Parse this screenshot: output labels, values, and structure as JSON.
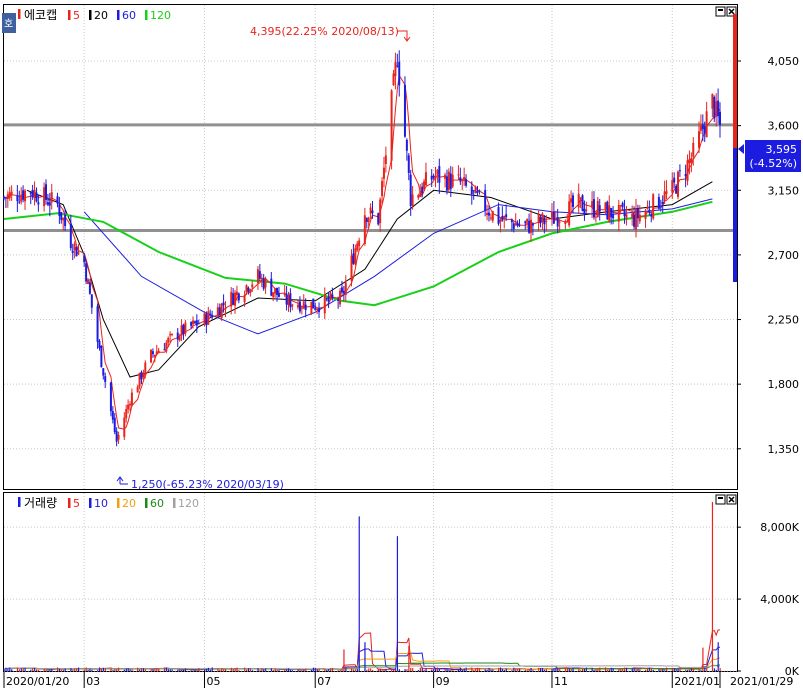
{
  "header": {
    "corner_label": "호",
    "price_title": "에코캡",
    "price_legend": [
      {
        "label": "5",
        "color": "#e8241c"
      },
      {
        "label": "20",
        "color": "#000000"
      },
      {
        "label": "60",
        "color": "#1c1ce0"
      },
      {
        "label": "120",
        "color": "#18d018"
      }
    ],
    "volume_title": "거래량",
    "volume_legend": [
      {
        "label": "5",
        "color": "#e8241c"
      },
      {
        "label": "10",
        "color": "#1c1ce0"
      },
      {
        "label": "20",
        "color": "#f0a010"
      },
      {
        "label": "60",
        "color": "#1a8a1a"
      },
      {
        "label": "120",
        "color": "#a0a0a0"
      }
    ]
  },
  "annotations": {
    "high": "4,395(22.25% 2020/08/13)",
    "low": "1,250(-65.23% 2020/03/19)"
  },
  "current": {
    "price": "3,595",
    "change": "(-4.52%)"
  },
  "colors": {
    "up": "#e8241c",
    "down": "#1c1ce0",
    "grid": "#c8c8c8",
    "level_line": "#909090",
    "ma5": "#e8241c",
    "ma20": "#000000",
    "ma60": "#1c1ce0",
    "ma120": "#18d018"
  },
  "chart_data": [
    {
      "type": "candlestick",
      "title": "에코캡",
      "y_ticks": [
        1350,
        1800,
        2250,
        2700,
        3150,
        3600,
        4050
      ],
      "y_tick_labels": [
        "1,350",
        "1,800",
        "2,250",
        "2,700",
        "3,150",
        "3,600",
        "4,050"
      ],
      "ylim": [
        1070,
        4440
      ],
      "horizontal_levels": [
        3605,
        2870
      ],
      "x_ticks": [
        {
          "label": "2020/01/20",
          "date": "2020/01/20"
        },
        {
          "label": "03",
          "date": "2020/03/02"
        },
        {
          "label": "05",
          "date": "2020/05/04"
        },
        {
          "label": "07",
          "date": "2020/07/01"
        },
        {
          "label": "09",
          "date": "2020/09/01"
        },
        {
          "label": "11",
          "date": "2020/11/02"
        },
        {
          "label": "2021/01",
          "date": "2021/01/04"
        },
        {
          "label": "2021/01/29",
          "date": "2021/01/29"
        }
      ],
      "x_range": [
        "2020/01/20",
        "2021/01/29"
      ],
      "series_close": [
        [
          "2020/01/20",
          3100
        ],
        [
          "2020/02/03",
          3150
        ],
        [
          "2020/02/17",
          3050
        ],
        [
          "2020/02/24",
          2800
        ],
        [
          "2020/03/02",
          2650
        ],
        [
          "2020/03/09",
          2100
        ],
        [
          "2020/03/19",
          1400
        ],
        [
          "2020/03/26",
          1700
        ],
        [
          "2020/04/06",
          2000
        ],
        [
          "2020/04/20",
          2150
        ],
        [
          "2020/05/04",
          2250
        ],
        [
          "2020/05/18",
          2400
        ],
        [
          "2020/06/01",
          2550
        ],
        [
          "2020/06/15",
          2380
        ],
        [
          "2020/07/01",
          2350
        ],
        [
          "2020/07/15",
          2400
        ],
        [
          "2020/07/27",
          3000
        ],
        [
          "2020/08/03",
          2950
        ],
        [
          "2020/08/13",
          4100
        ],
        [
          "2020/08/20",
          3100
        ],
        [
          "2020/09/01",
          3250
        ],
        [
          "2020/09/15",
          3200
        ],
        [
          "2020/10/05",
          2950
        ],
        [
          "2020/10/19",
          2900
        ],
        [
          "2020/11/02",
          2950
        ],
        [
          "2020/11/16",
          3050
        ],
        [
          "2020/12/01",
          3000
        ],
        [
          "2020/12/15",
          2950
        ],
        [
          "2021/01/04",
          3150
        ],
        [
          "2021/01/15",
          3400
        ],
        [
          "2021/01/25",
          3765
        ],
        [
          "2021/01/29",
          3595
        ]
      ],
      "moving_averages": [
        {
          "name": "20",
          "points": [
            [
              "2020/02/01",
              3150
            ],
            [
              "2020/02/20",
              3050
            ],
            [
              "2020/03/02",
              2700
            ],
            [
              "2020/03/12",
              2250
            ],
            [
              "2020/03/26",
              1850
            ],
            [
              "2020/04/10",
              1900
            ],
            [
              "2020/05/01",
              2200
            ],
            [
              "2020/06/01",
              2400
            ],
            [
              "2020/07/01",
              2380
            ],
            [
              "2020/07/27",
              2600
            ],
            [
              "2020/08/13",
              2950
            ],
            [
              "2020/09/01",
              3150
            ],
            [
              "2020/10/01",
              3100
            ],
            [
              "2020/11/02",
              2950
            ],
            [
              "2020/12/01",
              3000
            ],
            [
              "2021/01/04",
              3050
            ],
            [
              "2021/01/25",
              3210
            ]
          ]
        },
        {
          "name": "60",
          "points": [
            [
              "2020/03/02",
              3000
            ],
            [
              "2020/04/01",
              2550
            ],
            [
              "2020/05/04",
              2300
            ],
            [
              "2020/06/01",
              2150
            ],
            [
              "2020/07/01",
              2300
            ],
            [
              "2020/08/01",
              2550
            ],
            [
              "2020/09/01",
              2850
            ],
            [
              "2020/10/05",
              3050
            ],
            [
              "2020/11/02",
              3000
            ],
            [
              "2020/12/01",
              2980
            ],
            [
              "2021/01/04",
              3020
            ],
            [
              "2021/01/25",
              3090
            ]
          ]
        },
        {
          "name": "120",
          "points": [
            [
              "2020/01/20",
              2950
            ],
            [
              "2020/02/17",
              2990
            ],
            [
              "2020/03/12",
              2930
            ],
            [
              "2020/04/10",
              2720
            ],
            [
              "2020/05/15",
              2540
            ],
            [
              "2020/06/15",
              2500
            ],
            [
              "2020/07/15",
              2380
            ],
            [
              "2020/08/01",
              2350
            ],
            [
              "2020/09/01",
              2480
            ],
            [
              "2020/10/05",
              2720
            ],
            [
              "2020/11/02",
              2850
            ],
            [
              "2020/12/01",
              2930
            ],
            [
              "2021/01/04",
              3000
            ],
            [
              "2021/01/25",
              3070
            ]
          ]
        }
      ]
    },
    {
      "type": "bar",
      "title": "거래량",
      "y_ticks": [
        0,
        4000000,
        8000000
      ],
      "y_tick_labels": [
        "0K",
        "4,000K",
        "8,000K"
      ],
      "ylim": [
        0,
        9900000
      ],
      "spikes": [
        [
          "2020/07/16",
          1200000
        ],
        [
          "2020/07/24",
          8600000
        ],
        [
          "2020/07/27",
          1600000
        ],
        [
          "2020/08/13",
          7500000
        ],
        [
          "2020/08/19",
          1400000
        ],
        [
          "2021/01/20",
          1300000
        ],
        [
          "2021/01/25",
          9400000
        ],
        [
          "2021/01/28",
          1600000
        ]
      ]
    }
  ]
}
